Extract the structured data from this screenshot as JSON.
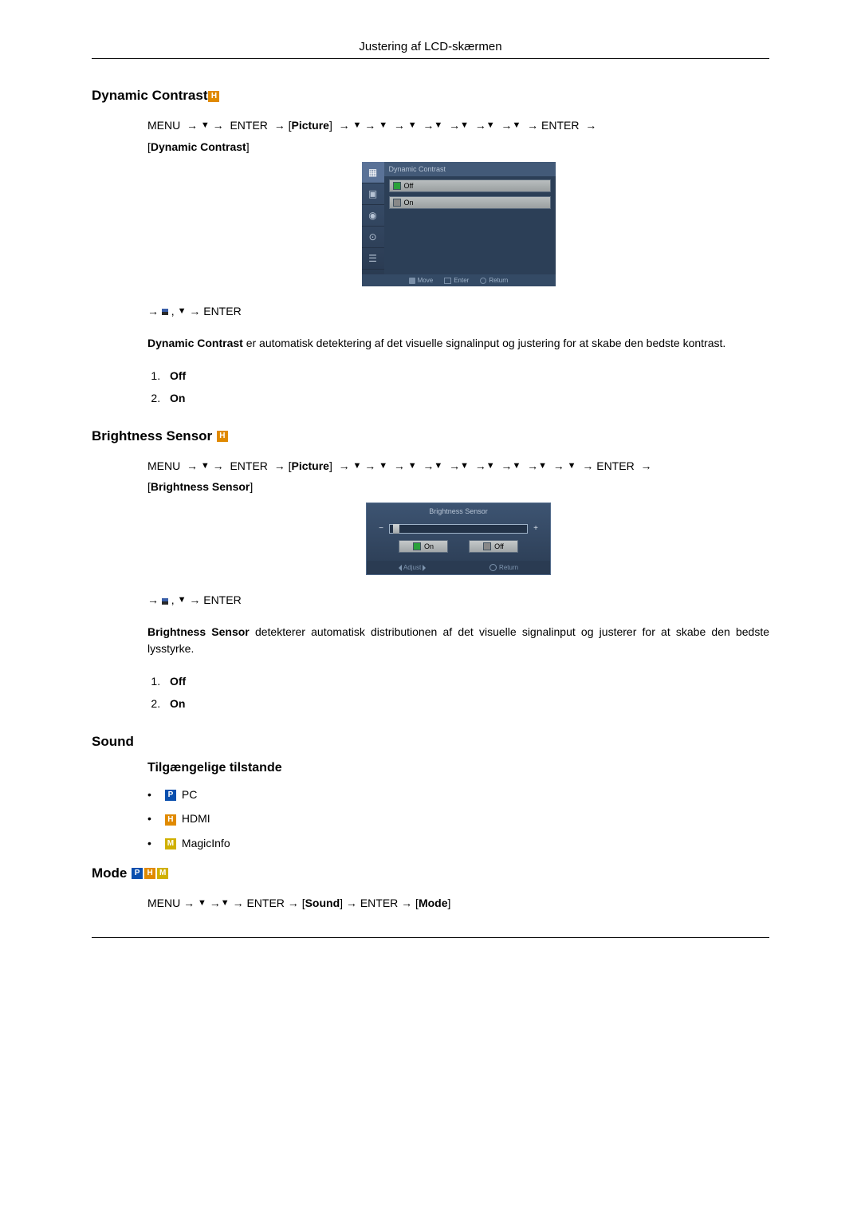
{
  "header": {
    "title": "Justering af LCD-skærmen"
  },
  "nav_words": {
    "menu": "MENU",
    "enter": "ENTER",
    "picture": "Picture",
    "sound_bracket": "Sound",
    "mode_bracket": "Mode"
  },
  "sections": {
    "dyn": {
      "title": "Dynamic Contrast",
      "bracket": "Dynamic Contrast",
      "osd": {
        "title": "Dynamic Contrast",
        "opt_off": "Off",
        "opt_on": "On",
        "foot_move": "Move",
        "foot_enter": "Enter",
        "foot_return": "Return"
      },
      "desc_bold": "Dynamic Contrast",
      "desc_rest": " er automatisk detektering af det visuelle signalinput og justering for at skabe den bedste kontrast.",
      "options": [
        "Off",
        "On"
      ]
    },
    "bright": {
      "title": "Brightness Sensor",
      "bracket": "Brightness Sensor",
      "osd": {
        "title": "Brightness Sensor",
        "on": "On",
        "off": "Off",
        "adjust": "Adjust",
        "return": "Return"
      },
      "desc_bold": "Brightness Sensor",
      "desc_rest": " detekterer automatisk distributionen af det visuelle signalinput og justerer for at skabe den bedste lysstyrke.",
      "options": [
        "Off",
        "On"
      ]
    },
    "sound": {
      "title": "Sound",
      "avail": "Tilgængelige tilstande",
      "modes": [
        {
          "badge": "P",
          "cls": "p",
          "label": "PC"
        },
        {
          "badge": "H",
          "cls": "h",
          "label": "HDMI"
        },
        {
          "badge": "M",
          "cls": "m",
          "label": "MagicInfo"
        }
      ]
    },
    "mode": {
      "title": "Mode"
    }
  }
}
